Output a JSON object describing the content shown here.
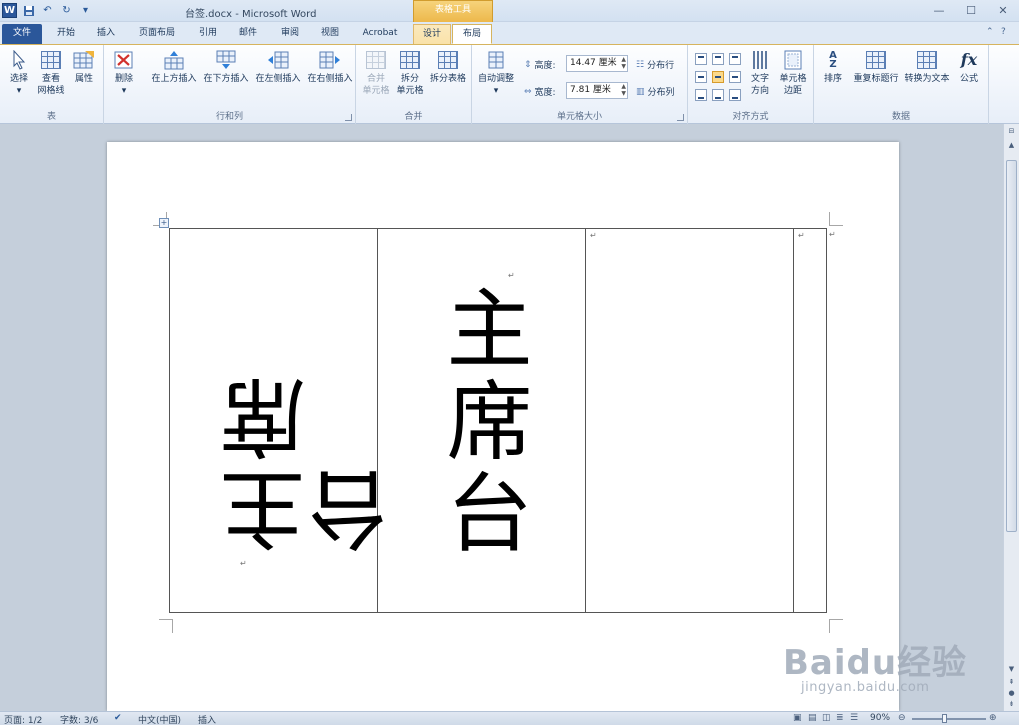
{
  "window": {
    "title": "台签.docx - Microsoft Word",
    "context_tab_group": "表格工具"
  },
  "tabs": [
    "文件",
    "开始",
    "插入",
    "页面布局",
    "引用",
    "邮件",
    "审阅",
    "视图",
    "Acrobat",
    "设计",
    "布局"
  ],
  "active_tab": "布局",
  "ribbon": {
    "groups": {
      "table": {
        "label": "表",
        "select": "选择",
        "view_gridlines_1": "查看",
        "view_gridlines_2": "网格线",
        "properties": "属性"
      },
      "rows_cols": {
        "label": "行和列",
        "delete": "删除",
        "insert_above": "在上方插入",
        "insert_below": "在下方插入",
        "insert_left": "在左侧插入",
        "insert_right": "在右侧插入"
      },
      "merge": {
        "label": "合并",
        "merge_cells_1": "合并",
        "merge_cells_2": "单元格",
        "split_cells_1": "拆分",
        "split_cells_2": "单元格",
        "split_table": "拆分表格"
      },
      "cell_size": {
        "label": "单元格大小",
        "autofit": "自动调整",
        "height_label": "高度:",
        "height_value": "14.47 厘米",
        "width_label": "宽度:",
        "width_value": "7.81 厘米",
        "distribute_rows": "分布行",
        "distribute_cols": "分布列"
      },
      "alignment": {
        "label": "对齐方式",
        "text_direction_1": "文字",
        "text_direction_2": "方向",
        "cell_margins_1": "单元格",
        "cell_margins_2": "边距"
      },
      "data": {
        "label": "数据",
        "sort": "排序",
        "repeat_header": "重复标题行",
        "convert_to_text": "转换为文本",
        "formula": "公式"
      }
    }
  },
  "document": {
    "cell1_text": "主席台",
    "cell2_text": "主席台"
  },
  "statusbar": {
    "page": "页面: 1/2",
    "words": "字数: 3/6",
    "language": "中文(中国)",
    "mode": "插入",
    "zoom": "90%",
    "zoom_fraction": 0.45
  },
  "watermark": {
    "line1": "Baidu经验",
    "line2": "jingyan.baidu.com"
  }
}
